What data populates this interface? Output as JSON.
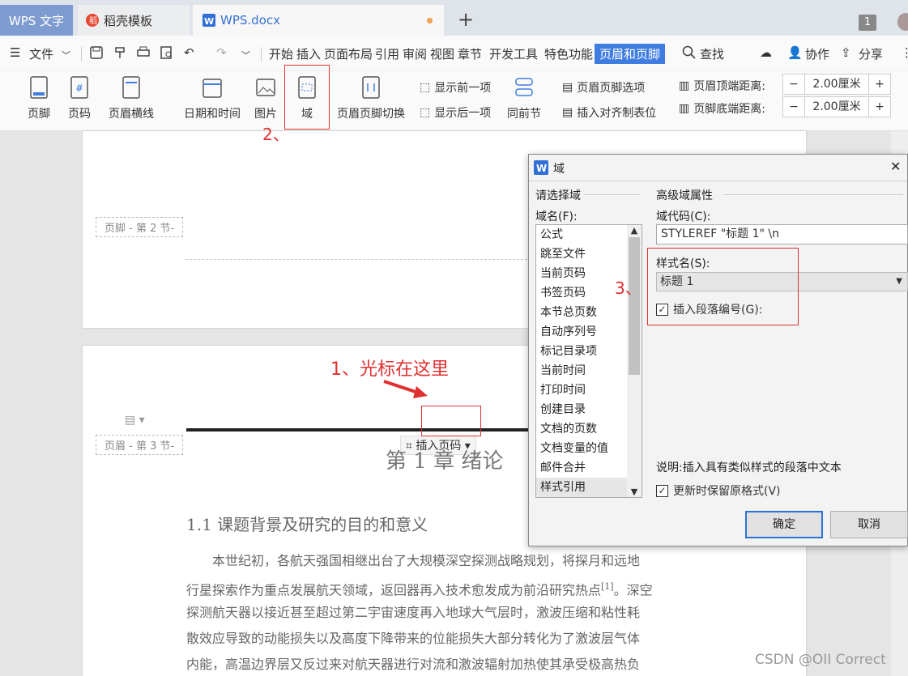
{
  "tabs": {
    "app": "WPS 文字",
    "template": "稻壳模板",
    "doc": "WPS.docx",
    "add": "+",
    "window_count": "1"
  },
  "menu": {
    "file": "文件",
    "items": [
      "开始",
      "插入",
      "页面布局",
      "引用",
      "审阅",
      "视图",
      "章节",
      "开发工具",
      "特色功能"
    ],
    "active": "页眉和页脚",
    "search": "查找",
    "collab": "协作",
    "share": "分享"
  },
  "ribbon": {
    "footer": "页脚",
    "pagenum": "页码",
    "header_line": "页眉横线",
    "datetime": "日期和时间",
    "picture": "图片",
    "field": "域",
    "switch": "页眉页脚切换",
    "show_prev": "显示前一项",
    "show_next": "显示后一项",
    "same_as_prev": "同前节",
    "options": "页眉页脚选项",
    "insert_tab": "插入对齐制表位",
    "header_top": "页眉顶端距离:",
    "header_top_val": "2.00厘米",
    "footer_bottom": "页脚底端距离:",
    "footer_bottom_val": "2.00厘米",
    "minus": "−",
    "plus": "+"
  },
  "doc": {
    "footer_label": "页脚 - 第 2 节-",
    "header_label": "页眉 - 第 3 节-",
    "insert_pagenum": "插入页码",
    "chapter": "第 1 章  绪论",
    "section": "1.1  课题背景及研究的目的和意义",
    "para": [
      "本世纪初，各航天强国相继出台了大规模深空探测战略规划，将探月和远地",
      "行星探索作为重点发展航天领域，返回器再入技术愈发成为前沿研究热点",
      "探测航天器以接近甚至超过第二宇宙速度再入地球大气层时，激波压缩和粘性耗",
      "散效应导致的动能损失以及高度下降带来的位能损失大部分转化为了激波层气体",
      "内能，高温边界层又反过来对航天器进行对流和激波辐射加热使其承受极高热负"
    ],
    "cite": "[1]",
    "para_tail": "。深空"
  },
  "dialog": {
    "title": "域",
    "choose": "请选择域",
    "fieldname": "域名(F):",
    "fields": [
      "公式",
      "跳至文件",
      "当前页码",
      "书签页码",
      "本节总页数",
      "自动序列号",
      "标记目录项",
      "当前时间",
      "打印时间",
      "创建目录",
      "文档的页数",
      "文档变量的值",
      "邮件合并",
      "样式引用"
    ],
    "adv": "高级域属性",
    "code_label": "域代码(C):",
    "code": "STYLEREF \"标题 1\" \\n",
    "style_label": "样式名(S):",
    "style": "标题 1",
    "insert_num": "插入段落编号(G):",
    "desc": "说明:插入具有类似样式的段落中文本",
    "keep": "更新时保留原格式(V)",
    "ok": "确定",
    "cancel": "取消",
    "close": "✕"
  },
  "annotations": {
    "a1": "1、光标在这里",
    "a2": "2、",
    "a3": "3、"
  },
  "watermark": "CSDN @OII Correct",
  "colors": {
    "accent": "#3f7de0",
    "annotation": "#e03030"
  }
}
